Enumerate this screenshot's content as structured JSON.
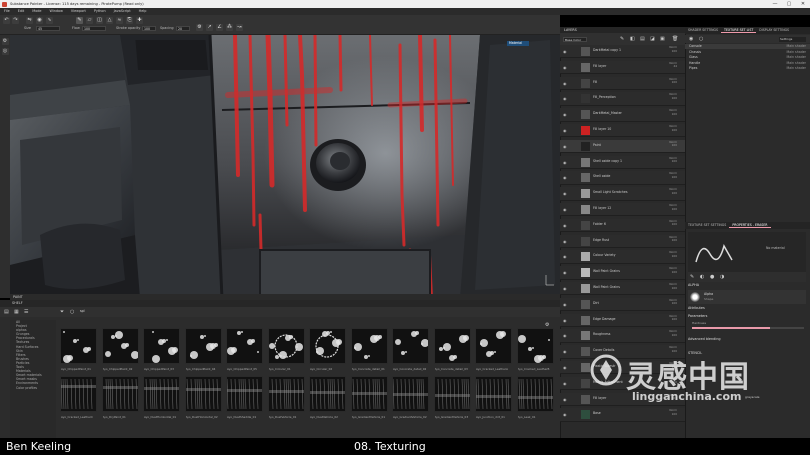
{
  "window": {
    "title": "Substance Painter - License: 115 days remaining - PiratePump (Read only)",
    "controls": [
      "—",
      "▢",
      "✕"
    ]
  },
  "menu": [
    "File",
    "Edit",
    "Mode",
    "Window",
    "Viewport",
    "Python",
    "JavaScript",
    "Help"
  ],
  "toolbar": {
    "size_label": "Size",
    "size_value": "45",
    "flow_label": "Flow",
    "flow_value": "100",
    "stroke_opacity_label": "Stroke opacity",
    "stroke_opacity_value": "100",
    "spacing_label": "Spacing",
    "spacing_value": "20"
  },
  "viewport": {
    "panel_label": "PAINT",
    "mode_select": "Material"
  },
  "shelf": {
    "title": "SHELF",
    "search_placeholder": "spl",
    "categories": [
      "All",
      "Project",
      "alphas",
      "Grunges",
      "Procedurals",
      "Textures",
      "Hard Surfaces",
      "Skin",
      "Filters",
      "Brushes",
      "Particles",
      "Tools",
      "Materials",
      "Smart materials",
      "Smart masks",
      "Environments",
      "Color profiles"
    ],
    "thumbs_row1": [
      "Ayo_ChippedPaint_01",
      "Ayo_ChippedPaint_02",
      "Ayo_ChippedPaint_03",
      "Ayo_ChippedPaint_04",
      "Ayo_ChippedPaint_05",
      "Ayo_Circular_01",
      "Ayo_Circular_02",
      "Ayo_Concrete_detail_01",
      "Ayo_Concrete_detail_02",
      "Ayo_Concrete_detail_03",
      "Ayo_Cracked_LeatherA",
      "Ayo_Cracked_LeatherB"
    ],
    "thumbs_row2": [
      "Ayo_Cracked_LeatherC",
      "Ayo_DryPaint_01",
      "Ayo_DustHorizontal_01",
      "Ayo_DustHorizontal_02",
      "Ayo_DustShaddle_01",
      "Ayo_DustVehicle_01",
      "Ayo_DustVehicle_02",
      "Ayo_GradientVehicle_01",
      "Ayo_GradientVehicle_02",
      "Ayo_GradientVehicle_03",
      "Ayo_Junction_dirt_01",
      "Ayo_Leak_01"
    ]
  },
  "layers": {
    "title": "LAYERS",
    "blend_select": "Base Color",
    "rows": [
      {
        "name": "DarkMetal copy 1",
        "blend": "Norm",
        "val": "100"
      },
      {
        "name": "Fill layer",
        "blend": "Norm",
        "val": "44"
      },
      {
        "name": "Fill",
        "blend": "Norm",
        "val": "100"
      },
      {
        "name": "Fill_Perception",
        "blend": "Norm",
        "val": "100"
      },
      {
        "name": "DarkMetal_Master",
        "blend": "Norm",
        "val": "100"
      },
      {
        "name": "Fill layer 10",
        "blend": "Norm",
        "val": "100"
      },
      {
        "name": "Paint",
        "blend": "Norm",
        "val": "100"
      },
      {
        "name": "Shell oxide copy 1",
        "blend": "Norm",
        "val": "100"
      },
      {
        "name": "Shell oxide",
        "blend": "Norm",
        "val": "100"
      },
      {
        "name": "Small Light Scratches",
        "blend": "Norm",
        "val": "100"
      },
      {
        "name": "Fill layer 12",
        "blend": "Norm",
        "val": "100"
      },
      {
        "name": "Folder 6",
        "blend": "Norm",
        "val": "100"
      },
      {
        "name": "Edge Rust",
        "blend": "Norm",
        "val": "100"
      },
      {
        "name": "Colour Variety",
        "blend": "Norm",
        "val": "100"
      },
      {
        "name": "Wall Paint Grains",
        "blend": "Norm",
        "val": "100"
      },
      {
        "name": "Wall Paint Grains",
        "blend": "Norm",
        "val": "100"
      },
      {
        "name": "Dirt",
        "blend": "Norm",
        "val": "100"
      },
      {
        "name": "Edge Damage",
        "blend": "Norm",
        "val": "100"
      },
      {
        "name": "Roughness",
        "blend": "Norm",
        "val": "100"
      },
      {
        "name": "Cover Details",
        "blend": "Norm",
        "val": "100"
      },
      {
        "name": "Plastic Sidestr",
        "blend": "Norm",
        "val": "100"
      },
      {
        "name": "Metals Adjustment",
        "blend": "Norm",
        "val": "100"
      },
      {
        "name": "Fill layer",
        "blend": "Norm",
        "val": "100"
      },
      {
        "name": "Base",
        "blend": "Norm",
        "val": "100"
      }
    ]
  },
  "texture_set": {
    "tabs": [
      "SHADER SETTINGS",
      "TEXTURE SET LIST",
      "DISPLAY SETTINGS"
    ],
    "active_tab": "TEXTURE SET LIST",
    "filter": "Settings",
    "rows": [
      {
        "name": "Console",
        "shader": "Main shader"
      },
      {
        "name": "Chassis",
        "shader": "Main shader"
      },
      {
        "name": "Glass",
        "shader": "Main shader"
      },
      {
        "name": "Handle",
        "shader": "Main shader"
      },
      {
        "name": "Pipes",
        "shader": "Main shader"
      }
    ]
  },
  "properties": {
    "tabs": [
      "TEXTURE SET SETTINGS",
      "PROPERTIES - ERASER"
    ],
    "active_tab": "PROPERTIES - ERASER",
    "no_material": "No material",
    "alpha_section": "ALPHA",
    "alpha_name": "Alpha",
    "alpha_sub": "Shape",
    "attributes": "Attributes",
    "parameters": "Parameters",
    "hardness_label": "Hardness",
    "advanced": "Advanced blending",
    "stencil": "STENCIL",
    "image_label": "grayscale"
  },
  "caption": {
    "presenter": "Ben Keeling",
    "lesson": "08. Texturing"
  },
  "watermark": {
    "cn": "灵感中国",
    "en": "lingganchina.com"
  },
  "colors": {
    "accent_pink": "#e99aaa",
    "paint_red": "#d42a2a",
    "panel_bg": "#2a2a2a"
  }
}
